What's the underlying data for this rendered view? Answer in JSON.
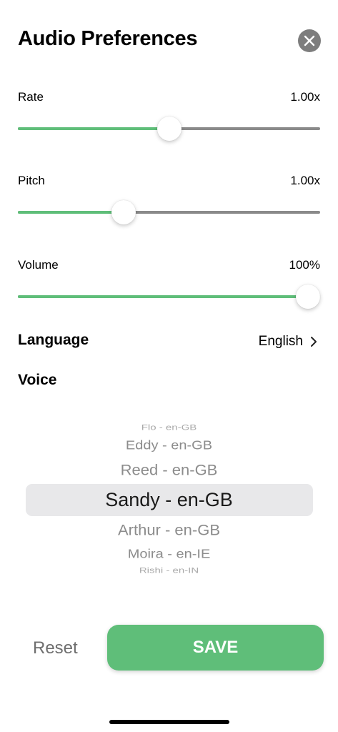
{
  "header": {
    "title": "Audio Preferences",
    "close_icon": "close-icon"
  },
  "sliders": {
    "rate": {
      "label": "Rate",
      "value_text": "1.00x",
      "fraction": 0.5
    },
    "pitch": {
      "label": "Pitch",
      "value_text": "1.00x",
      "fraction": 0.35
    },
    "volume": {
      "label": "Volume",
      "value_text": "100%",
      "fraction": 1.0
    }
  },
  "language": {
    "label": "Language",
    "value": "English",
    "chevron_icon": "chevron-right-icon"
  },
  "voice": {
    "label": "Voice",
    "options": [
      {
        "label": "Flo - en-GB"
      },
      {
        "label": "Eddy - en-GB"
      },
      {
        "label": "Reed - en-GB"
      },
      {
        "label": "Sandy - en-GB",
        "selected": true
      },
      {
        "label": "Arthur - en-GB"
      },
      {
        "label": "Moira - en-IE"
      },
      {
        "label": "Rishi - en-IN"
      }
    ]
  },
  "footer": {
    "reset_label": "Reset",
    "save_label": "SAVE"
  },
  "colors": {
    "accent": "#5fbe79",
    "track": "#8a8a8a",
    "close_bg": "#7d7d7d",
    "picker_highlight": "#e8e8ea"
  }
}
